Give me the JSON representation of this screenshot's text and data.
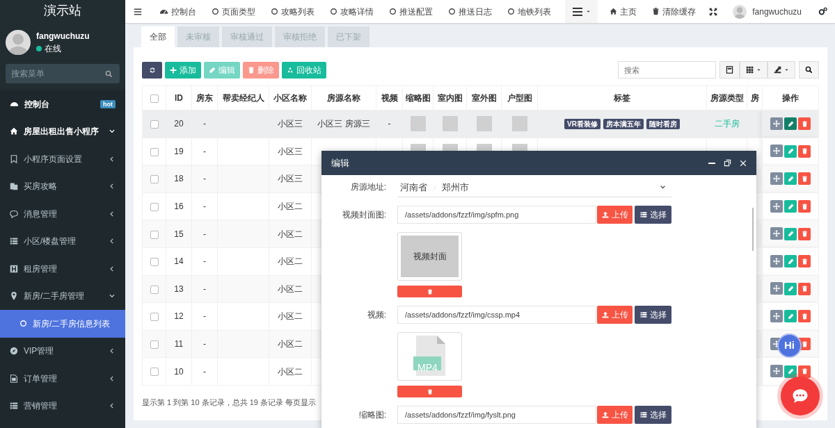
{
  "sidebar": {
    "title": "演示站",
    "user": {
      "name": "fangwuchuzu",
      "status": "在线",
      "online": true
    },
    "search": {
      "placeholder": "搜索菜单"
    },
    "menu": [
      {
        "label": "控制台",
        "badge": "hot",
        "selected": false
      },
      {
        "label": "房屋出租出售小程序",
        "expanded": true,
        "selected": false,
        "children": [
          {
            "label": "小程序页面设置",
            "expanded": false,
            "selected": false
          },
          {
            "label": "买房攻略",
            "expanded": false,
            "selected": false
          },
          {
            "label": "消息管理",
            "expanded": false,
            "selected": false
          },
          {
            "label": "小区/楼盘管理",
            "expanded": false,
            "selected": false
          },
          {
            "label": "租房管理",
            "expanded": false,
            "selected": false
          },
          {
            "label": "新房/二手房管理",
            "expanded": true,
            "selected": false,
            "children": [
              {
                "label": "新房/二手房信息列表",
                "selected": true
              }
            ]
          },
          {
            "label": "VIP管理",
            "expanded": false,
            "selected": false
          },
          {
            "label": "订单管理",
            "expanded": false,
            "selected": false
          },
          {
            "label": "营销管理",
            "expanded": false,
            "selected": false
          }
        ]
      }
    ]
  },
  "topnav": {
    "items": [
      {
        "kind": "dashboard",
        "label": "控制台"
      },
      {
        "kind": "page",
        "label": "页面类型"
      },
      {
        "kind": "page",
        "label": "攻略列表"
      },
      {
        "kind": "page",
        "label": "攻略详情"
      },
      {
        "kind": "page",
        "label": "推送配置"
      },
      {
        "kind": "page",
        "label": "推送日志"
      },
      {
        "kind": "page",
        "label": "地铁列表"
      }
    ],
    "home": "主页",
    "clear_cache": "清除缓存",
    "user_name": "fangwuchuzu"
  },
  "tabs": [
    {
      "label": "全部",
      "selected": true
    },
    {
      "label": "未审核",
      "selected": false
    },
    {
      "label": "审核通过",
      "selected": false
    },
    {
      "label": "审核拒绝",
      "selected": false
    },
    {
      "label": "已下架",
      "selected": false
    }
  ],
  "toolbar": {
    "buttons": [
      {
        "kind": "refresh",
        "disabled": false
      },
      {
        "kind": "add",
        "label": "添加",
        "disabled": false
      },
      {
        "kind": "edit",
        "label": "编辑",
        "disabled": true
      },
      {
        "kind": "delete",
        "label": "删除",
        "disabled": true
      },
      {
        "kind": "recycle",
        "label": "回收站",
        "disabled": false
      }
    ],
    "search": {
      "placeholder": "搜索"
    }
  },
  "table": {
    "columns": [
      "ID",
      "房东",
      "帮卖经纪人",
      "小区名称",
      "房源名称",
      "视频",
      "缩略图",
      "室内图",
      "室外图",
      "户型图",
      "标签",
      "房源类型",
      "房",
      "操作"
    ],
    "rows": [
      {
        "id": "20",
        "landlord": "-",
        "community": "小区三",
        "name": "小区三 房源三",
        "video": "-",
        "tags": [
          "VR看装修",
          "房本满五年",
          "随时看房"
        ],
        "type": "二手房",
        "checked": false,
        "hovered": true
      },
      {
        "id": "19",
        "landlord": "-",
        "community": "小区三",
        "checked": false,
        "hovered": false
      },
      {
        "id": "18",
        "landlord": "-",
        "community": "小区三",
        "checked": false,
        "hovered": false
      },
      {
        "id": "16",
        "landlord": "-",
        "community": "小区二",
        "checked": false,
        "hovered": false
      },
      {
        "id": "15",
        "landlord": "-",
        "community": "小区二",
        "checked": false,
        "hovered": false
      },
      {
        "id": "14",
        "landlord": "-",
        "community": "小区二",
        "checked": false,
        "hovered": false
      },
      {
        "id": "13",
        "landlord": "-",
        "community": "小区二",
        "checked": false,
        "hovered": false
      },
      {
        "id": "12",
        "landlord": "-",
        "community": "小区二",
        "checked": false,
        "hovered": false
      },
      {
        "id": "11",
        "landlord": "-",
        "community": "小区二",
        "checked": false,
        "hovered": false
      },
      {
        "id": "10",
        "landlord": "-",
        "community": "小区二",
        "checked": false,
        "hovered": false
      }
    ],
    "select_all_checked": false,
    "footer": "显示第 1 到第 10 条记录，总共 19 条记录 每页显示"
  },
  "modal": {
    "title": "编辑",
    "fields": [
      {
        "kind": "region",
        "label": "房源地址:",
        "parts": [
          "河南省",
          "郑州市"
        ]
      },
      {
        "kind": "upload",
        "label": "视频封面图:",
        "value": "/assets/addons/fzzf/img/spfm.png",
        "upload": "上传",
        "choose": "选择",
        "preview": {
          "kind": "image",
          "caption": "视频封面"
        }
      },
      {
        "kind": "upload",
        "label": "视频:",
        "value": "/assets/addons/fzzf/img/cssp.mp4",
        "upload": "上传",
        "choose": "选择",
        "preview": {
          "kind": "file",
          "ext": "MP4"
        }
      },
      {
        "kind": "upload",
        "label": "缩略图:",
        "value": "/assets/addons/fzzf/img/fyslt.png",
        "upload": "上传",
        "choose": "选择"
      }
    ]
  },
  "hi_button": "Hi"
}
